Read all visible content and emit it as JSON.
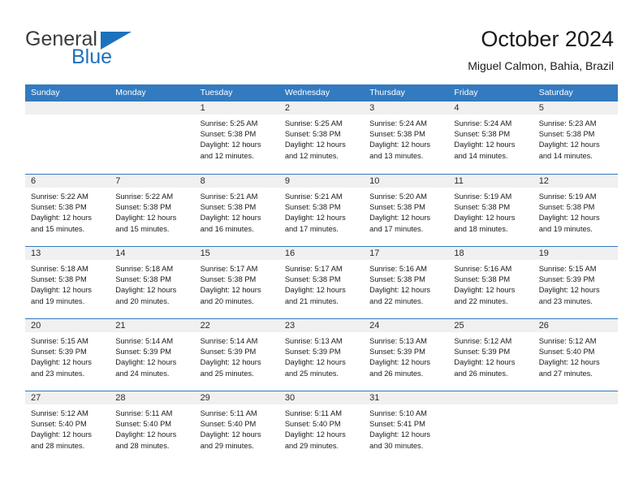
{
  "brand": {
    "line1": "General",
    "line2": "Blue",
    "triangle_icon": "triangle-icon",
    "color_text": "#3b3b3b",
    "color_blue": "#1c72bd"
  },
  "header": {
    "title": "October 2024",
    "subtitle": "Miguel Calmon, Bahia, Brazil"
  },
  "calendar": {
    "accent_color": "#337ac0",
    "day_band_color": "#f0f0f0",
    "day_names": [
      "Sunday",
      "Monday",
      "Tuesday",
      "Wednesday",
      "Thursday",
      "Friday",
      "Saturday"
    ],
    "weeks": [
      [
        {
          "day": "",
          "sunrise": "",
          "sunset": "",
          "daylight1": "",
          "daylight2": ""
        },
        {
          "day": "",
          "sunrise": "",
          "sunset": "",
          "daylight1": "",
          "daylight2": ""
        },
        {
          "day": "1",
          "sunrise": "Sunrise: 5:25 AM",
          "sunset": "Sunset: 5:38 PM",
          "daylight1": "Daylight: 12 hours",
          "daylight2": "and 12 minutes."
        },
        {
          "day": "2",
          "sunrise": "Sunrise: 5:25 AM",
          "sunset": "Sunset: 5:38 PM",
          "daylight1": "Daylight: 12 hours",
          "daylight2": "and 12 minutes."
        },
        {
          "day": "3",
          "sunrise": "Sunrise: 5:24 AM",
          "sunset": "Sunset: 5:38 PM",
          "daylight1": "Daylight: 12 hours",
          "daylight2": "and 13 minutes."
        },
        {
          "day": "4",
          "sunrise": "Sunrise: 5:24 AM",
          "sunset": "Sunset: 5:38 PM",
          "daylight1": "Daylight: 12 hours",
          "daylight2": "and 14 minutes."
        },
        {
          "day": "5",
          "sunrise": "Sunrise: 5:23 AM",
          "sunset": "Sunset: 5:38 PM",
          "daylight1": "Daylight: 12 hours",
          "daylight2": "and 14 minutes."
        }
      ],
      [
        {
          "day": "6",
          "sunrise": "Sunrise: 5:22 AM",
          "sunset": "Sunset: 5:38 PM",
          "daylight1": "Daylight: 12 hours",
          "daylight2": "and 15 minutes."
        },
        {
          "day": "7",
          "sunrise": "Sunrise: 5:22 AM",
          "sunset": "Sunset: 5:38 PM",
          "daylight1": "Daylight: 12 hours",
          "daylight2": "and 15 minutes."
        },
        {
          "day": "8",
          "sunrise": "Sunrise: 5:21 AM",
          "sunset": "Sunset: 5:38 PM",
          "daylight1": "Daylight: 12 hours",
          "daylight2": "and 16 minutes."
        },
        {
          "day": "9",
          "sunrise": "Sunrise: 5:21 AM",
          "sunset": "Sunset: 5:38 PM",
          "daylight1": "Daylight: 12 hours",
          "daylight2": "and 17 minutes."
        },
        {
          "day": "10",
          "sunrise": "Sunrise: 5:20 AM",
          "sunset": "Sunset: 5:38 PM",
          "daylight1": "Daylight: 12 hours",
          "daylight2": "and 17 minutes."
        },
        {
          "day": "11",
          "sunrise": "Sunrise: 5:19 AM",
          "sunset": "Sunset: 5:38 PM",
          "daylight1": "Daylight: 12 hours",
          "daylight2": "and 18 minutes."
        },
        {
          "day": "12",
          "sunrise": "Sunrise: 5:19 AM",
          "sunset": "Sunset: 5:38 PM",
          "daylight1": "Daylight: 12 hours",
          "daylight2": "and 19 minutes."
        }
      ],
      [
        {
          "day": "13",
          "sunrise": "Sunrise: 5:18 AM",
          "sunset": "Sunset: 5:38 PM",
          "daylight1": "Daylight: 12 hours",
          "daylight2": "and 19 minutes."
        },
        {
          "day": "14",
          "sunrise": "Sunrise: 5:18 AM",
          "sunset": "Sunset: 5:38 PM",
          "daylight1": "Daylight: 12 hours",
          "daylight2": "and 20 minutes."
        },
        {
          "day": "15",
          "sunrise": "Sunrise: 5:17 AM",
          "sunset": "Sunset: 5:38 PM",
          "daylight1": "Daylight: 12 hours",
          "daylight2": "and 20 minutes."
        },
        {
          "day": "16",
          "sunrise": "Sunrise: 5:17 AM",
          "sunset": "Sunset: 5:38 PM",
          "daylight1": "Daylight: 12 hours",
          "daylight2": "and 21 minutes."
        },
        {
          "day": "17",
          "sunrise": "Sunrise: 5:16 AM",
          "sunset": "Sunset: 5:38 PM",
          "daylight1": "Daylight: 12 hours",
          "daylight2": "and 22 minutes."
        },
        {
          "day": "18",
          "sunrise": "Sunrise: 5:16 AM",
          "sunset": "Sunset: 5:38 PM",
          "daylight1": "Daylight: 12 hours",
          "daylight2": "and 22 minutes."
        },
        {
          "day": "19",
          "sunrise": "Sunrise: 5:15 AM",
          "sunset": "Sunset: 5:39 PM",
          "daylight1": "Daylight: 12 hours",
          "daylight2": "and 23 minutes."
        }
      ],
      [
        {
          "day": "20",
          "sunrise": "Sunrise: 5:15 AM",
          "sunset": "Sunset: 5:39 PM",
          "daylight1": "Daylight: 12 hours",
          "daylight2": "and 23 minutes."
        },
        {
          "day": "21",
          "sunrise": "Sunrise: 5:14 AM",
          "sunset": "Sunset: 5:39 PM",
          "daylight1": "Daylight: 12 hours",
          "daylight2": "and 24 minutes."
        },
        {
          "day": "22",
          "sunrise": "Sunrise: 5:14 AM",
          "sunset": "Sunset: 5:39 PM",
          "daylight1": "Daylight: 12 hours",
          "daylight2": "and 25 minutes."
        },
        {
          "day": "23",
          "sunrise": "Sunrise: 5:13 AM",
          "sunset": "Sunset: 5:39 PM",
          "daylight1": "Daylight: 12 hours",
          "daylight2": "and 25 minutes."
        },
        {
          "day": "24",
          "sunrise": "Sunrise: 5:13 AM",
          "sunset": "Sunset: 5:39 PM",
          "daylight1": "Daylight: 12 hours",
          "daylight2": "and 26 minutes."
        },
        {
          "day": "25",
          "sunrise": "Sunrise: 5:12 AM",
          "sunset": "Sunset: 5:39 PM",
          "daylight1": "Daylight: 12 hours",
          "daylight2": "and 26 minutes."
        },
        {
          "day": "26",
          "sunrise": "Sunrise: 5:12 AM",
          "sunset": "Sunset: 5:40 PM",
          "daylight1": "Daylight: 12 hours",
          "daylight2": "and 27 minutes."
        }
      ],
      [
        {
          "day": "27",
          "sunrise": "Sunrise: 5:12 AM",
          "sunset": "Sunset: 5:40 PM",
          "daylight1": "Daylight: 12 hours",
          "daylight2": "and 28 minutes."
        },
        {
          "day": "28",
          "sunrise": "Sunrise: 5:11 AM",
          "sunset": "Sunset: 5:40 PM",
          "daylight1": "Daylight: 12 hours",
          "daylight2": "and 28 minutes."
        },
        {
          "day": "29",
          "sunrise": "Sunrise: 5:11 AM",
          "sunset": "Sunset: 5:40 PM",
          "daylight1": "Daylight: 12 hours",
          "daylight2": "and 29 minutes."
        },
        {
          "day": "30",
          "sunrise": "Sunrise: 5:11 AM",
          "sunset": "Sunset: 5:40 PM",
          "daylight1": "Daylight: 12 hours",
          "daylight2": "and 29 minutes."
        },
        {
          "day": "31",
          "sunrise": "Sunrise: 5:10 AM",
          "sunset": "Sunset: 5:41 PM",
          "daylight1": "Daylight: 12 hours",
          "daylight2": "and 30 minutes."
        },
        {
          "day": "",
          "sunrise": "",
          "sunset": "",
          "daylight1": "",
          "daylight2": ""
        },
        {
          "day": "",
          "sunrise": "",
          "sunset": "",
          "daylight1": "",
          "daylight2": ""
        }
      ]
    ]
  }
}
